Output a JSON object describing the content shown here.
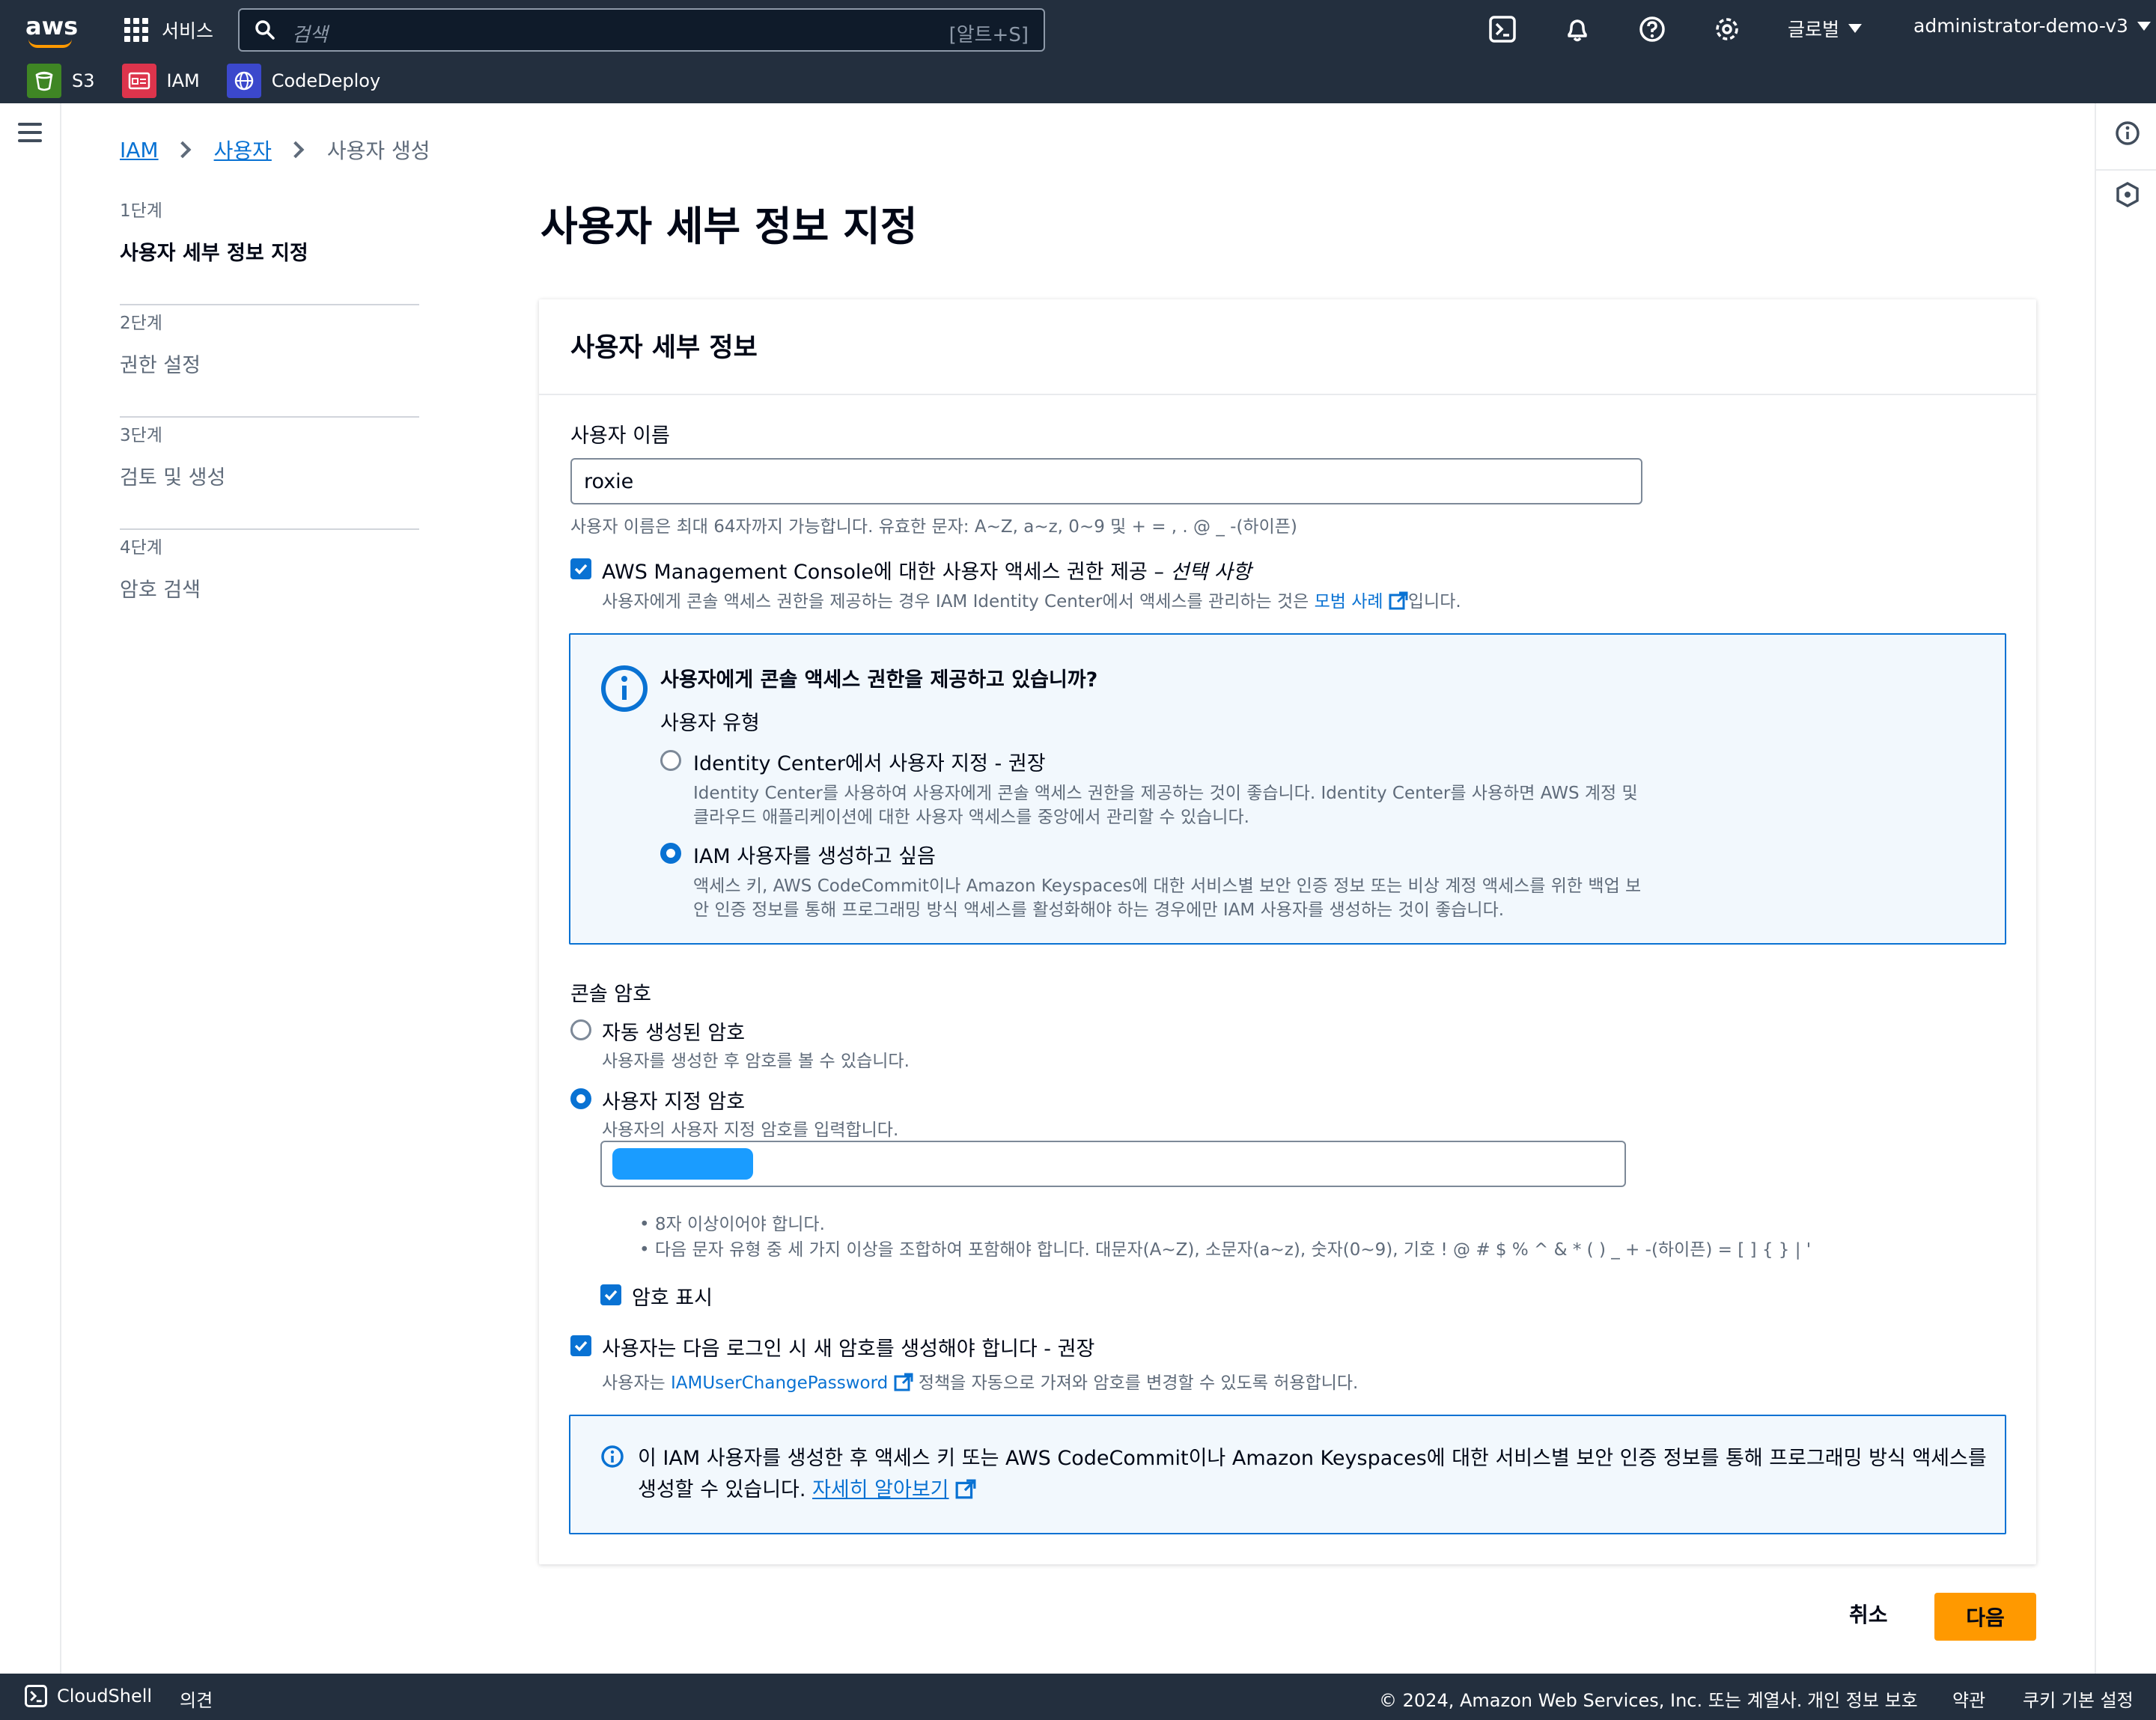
{
  "topnav": {
    "logo_text": "aws",
    "services_label": "서비스",
    "search_placeholder": "검색",
    "search_shortcut": "[알트+S]",
    "region_label": "글로벌",
    "account_label": "administrator-demo-v3",
    "icons": [
      "cloudshell-icon",
      "bell-icon",
      "help-icon",
      "gear-icon"
    ]
  },
  "favorites": [
    {
      "label": "S3",
      "color": "#3f8624"
    },
    {
      "label": "IAM",
      "color": "#dd344c"
    },
    {
      "label": "CodeDeploy",
      "color": "#3b48cc"
    }
  ],
  "breadcrumb": {
    "items": [
      "IAM",
      "사용자"
    ],
    "current": "사용자 생성"
  },
  "steps": [
    {
      "num": "1단계",
      "title": "사용자 세부 정보 지정",
      "active": true
    },
    {
      "num": "2단계",
      "title": "권한 설정"
    },
    {
      "num": "3단계",
      "title": "검토 및 생성"
    },
    {
      "num": "4단계",
      "title": "암호 검색"
    }
  ],
  "page_title": "사용자 세부 정보 지정",
  "details": {
    "header": "사용자 세부 정보",
    "username_label": "사용자 이름",
    "username_value": "roxie",
    "username_hint": "사용자 이름은 최대 64자까지 가능합니다. 유효한 문자: A~Z, a~z, 0~9 및 + = , . @ _ -(하이픈)",
    "console_access_label": "AWS Management Console에 대한 사용자 액세스 권한 제공 –",
    "console_access_optional": "선택 사항",
    "console_access_desc_pre": "사용자에게 콘솔 액세스 권한을 제공하는 경우 IAM Identity Center에서 액세스를 관리하는 것은",
    "console_access_link": "모범 사례",
    "console_access_desc_post": "입니다.",
    "info_title": "사용자에게 콘솔 액세스 권한을 제공하고 있습니까?",
    "user_type_label": "사용자 유형",
    "option_identity_center": "Identity Center에서 사용자 지정 - 권장",
    "option_identity_center_desc1": "Identity Center를 사용하여 사용자에게 콘솔 액세스 권한을 제공하는 것이 좋습니다. Identity Center를 사용하면 AWS 계정 및",
    "option_identity_center_desc2": "클라우드 애플리케이션에 대한 사용자 액세스를 중앙에서 관리할 수 있습니다.",
    "option_iam_user": "IAM 사용자를 생성하고 싶음",
    "option_iam_user_desc1": "액세스 키, AWS CodeCommit이나 Amazon Keyspaces에 대한 서비스별 보안 인증 정보 또는 비상 계정 액세스를 위한 백업 보",
    "option_iam_user_desc2": "안 인증 정보를 통해 프로그래밍 방식 액세스를 활성화해야 하는 경우에만 IAM 사용자를 생성하는 것이 좋습니다.",
    "console_password_label": "콘솔 암호",
    "auto_password": "자동 생성된 암호",
    "auto_password_desc": "사용자를 생성한 후 암호를 볼 수 있습니다.",
    "custom_password": "사용자 지정 암호",
    "custom_password_desc": "사용자의 사용자 지정 암호를 입력합니다.",
    "password_rule1": "8자 이상이어야 합니다.",
    "password_rule2": "다음 문자 유형 중 세 가지 이상을 조합하여 포함해야 합니다. 대문자(A~Z), 소문자(a~z), 숫자(0~9), 기호 ! @ # $ % ^ & * ( ) _ + -(하이픈) = [ ] { } | '",
    "show_password": "암호 표시",
    "must_reset": "사용자는 다음 로그인 시 새 암호를 생성해야 합니다 - 권장",
    "must_reset_desc_pre": "사용자는",
    "must_reset_link": "IAMUserChangePassword",
    "must_reset_desc_post": "정책을 자동으로 가져와 암호를 변경할 수 있도록 허용합니다.",
    "bottom_info_line1": "이 IAM 사용자를 생성한 후 액세스 키 또는 AWS CodeCommit이나 Amazon Keyspaces에 대한 서비스별 보안 인증 정보를 통해 프로그래밍 방식 액세스를",
    "bottom_info_line2": "생성할 수 있습니다.",
    "bottom_info_link": "자세히 알아보기"
  },
  "actions": {
    "cancel": "취소",
    "next": "다음"
  },
  "footer": {
    "cloudshell": "CloudShell",
    "feedback": "의견",
    "copyright": "© 2024, Amazon Web Services, Inc. 또는 계열사.",
    "privacy": "개인 정보 보호",
    "terms": "약관",
    "cookies": "쿠키 기본 설정"
  },
  "colors": {
    "accent": "#0972d3",
    "primary_button": "#ff9900",
    "nav_bg": "#232f3e"
  }
}
